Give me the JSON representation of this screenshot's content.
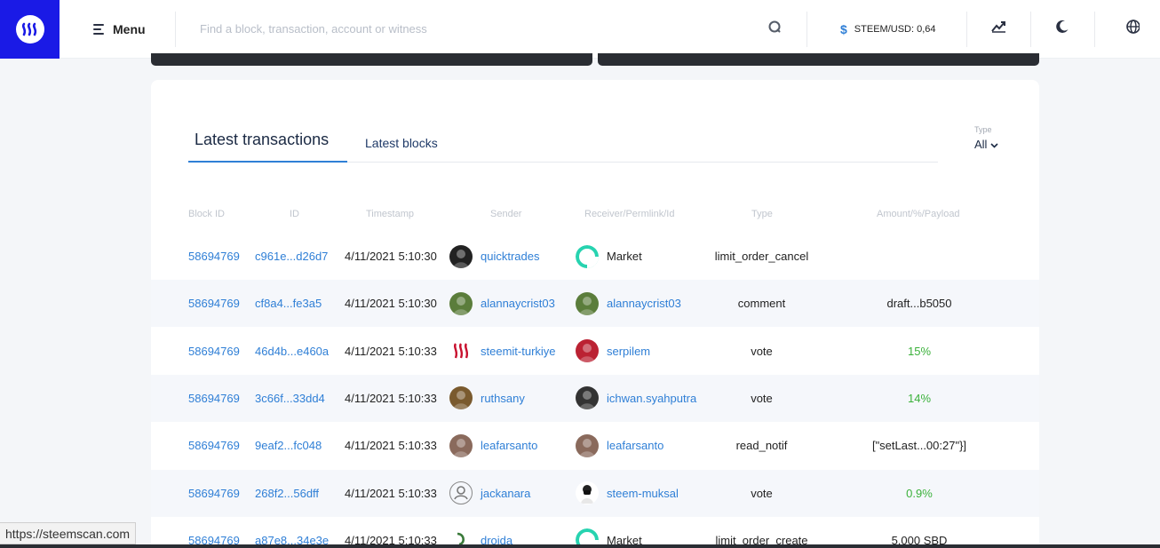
{
  "header": {
    "menu_label": "Menu",
    "search_placeholder": "Find a block, transaction, account or witness",
    "price_label": "STEEM/USD: 0,64",
    "price_symbol": "$"
  },
  "tabs": [
    {
      "label": "Latest transactions",
      "active": true
    },
    {
      "label": "Latest blocks",
      "active": false
    }
  ],
  "filter": {
    "label": "Type",
    "value": "All"
  },
  "columns": [
    "Block ID",
    "ID",
    "Timestamp",
    "Sender",
    "Receiver/Permlink/Id",
    "Type",
    "Amount/%/Payload"
  ],
  "rows": [
    {
      "block": "58694769",
      "id": "c961e...d26d7",
      "time": "4/11/2021 5:10:30",
      "sender": "quicktrades",
      "receiver": "Market",
      "receiver_link": false,
      "type": "limit_order_cancel",
      "amount": "",
      "amount_style": "plain"
    },
    {
      "block": "58694769",
      "id": "cf8a4...fe3a5",
      "time": "4/11/2021 5:10:30",
      "sender": "alannaycrist03",
      "receiver": "alannaycrist03",
      "receiver_link": true,
      "type": "comment",
      "amount": "draft...b5050",
      "amount_style": "plain"
    },
    {
      "block": "58694769",
      "id": "46d4b...e460a",
      "time": "4/11/2021 5:10:33",
      "sender": "steemit-turkiye",
      "receiver": "serpilem",
      "receiver_link": true,
      "type": "vote",
      "amount": "15%",
      "amount_style": "green"
    },
    {
      "block": "58694769",
      "id": "3c66f...33dd4",
      "time": "4/11/2021 5:10:33",
      "sender": "ruthsany",
      "receiver": "ichwan.syahputra",
      "receiver_link": true,
      "type": "vote",
      "amount": "14%",
      "amount_style": "green"
    },
    {
      "block": "58694769",
      "id": "9eaf2...fc048",
      "time": "4/11/2021 5:10:33",
      "sender": "leafarsanto",
      "receiver": "leafarsanto",
      "receiver_link": true,
      "type": "read_notif",
      "amount": "[\"setLast...00:27\"}]",
      "amount_style": "plain"
    },
    {
      "block": "58694769",
      "id": "268f2...56dff",
      "time": "4/11/2021 5:10:33",
      "sender": "jackanara",
      "receiver": "steem-muksal",
      "receiver_link": true,
      "type": "vote",
      "amount": "0.9%",
      "amount_style": "green"
    },
    {
      "block": "58694769",
      "id": "a87e8...34e3e",
      "time": "4/11/2021 5:10:33",
      "sender": "droida",
      "receiver": "Market",
      "receiver_link": false,
      "type": "limit_order_create",
      "amount": "5.000 SBD",
      "amount_style": "plain"
    }
  ],
  "status_bar": {
    "url": "https://steemscan.com"
  },
  "colors": {
    "brand": "#1a1ae6",
    "link": "#2f7fd6",
    "positive": "#3bb13b"
  },
  "icons": [
    "steem-logo-icon",
    "menu-icon",
    "search-icon",
    "dollar-icon",
    "chart-icon",
    "moon-icon",
    "globe-icon",
    "chevron-down-icon"
  ]
}
